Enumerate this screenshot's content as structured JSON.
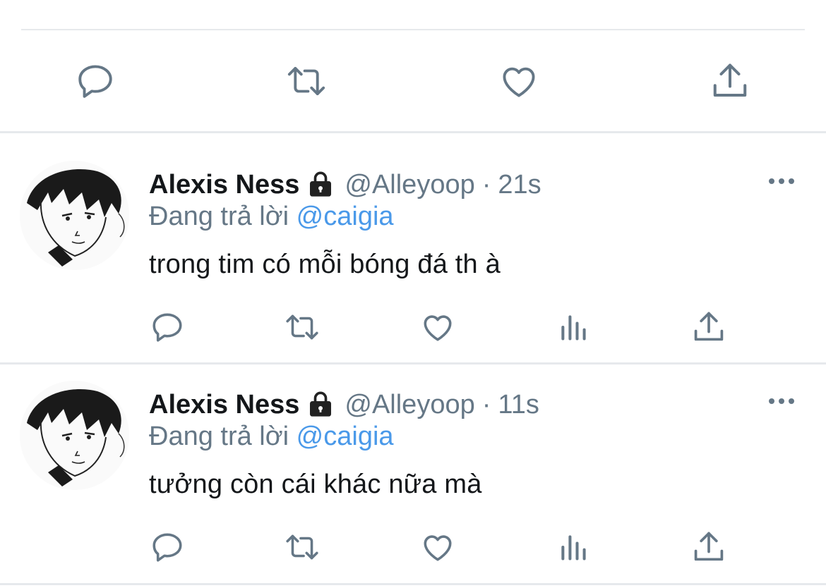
{
  "colors": {
    "icon": "#657786",
    "mention": "#4a99e9",
    "divider": "#e6e9ec",
    "text": "#14171a"
  },
  "top_tweet": {
    "actions": [
      {
        "name": "reply",
        "icon": "reply-icon"
      },
      {
        "name": "retweet",
        "icon": "retweet-icon"
      },
      {
        "name": "like",
        "icon": "heart-icon"
      },
      {
        "name": "share",
        "icon": "share-icon"
      }
    ]
  },
  "tweets": [
    {
      "name": "Alexis Ness",
      "protected_icon": "lock-icon",
      "handle": "@Alleyoop",
      "separator": "·",
      "time": "21s",
      "replying_prefix": "Đang trả lời",
      "replying_to": "@caigia",
      "text": "trong tim có mỗi bóng đá th à",
      "actions": [
        "reply-icon",
        "retweet-icon",
        "heart-icon",
        "analytics-icon",
        "share-icon"
      ]
    },
    {
      "name": "Alexis Ness",
      "protected_icon": "lock-icon",
      "handle": "@Alleyoop",
      "separator": "·",
      "time": "11s",
      "replying_prefix": "Đang trả lời",
      "replying_to": "@caigia",
      "text": "tưởng còn cái khác nữa mà",
      "actions": [
        "reply-icon",
        "retweet-icon",
        "heart-icon",
        "analytics-icon",
        "share-icon"
      ]
    }
  ]
}
